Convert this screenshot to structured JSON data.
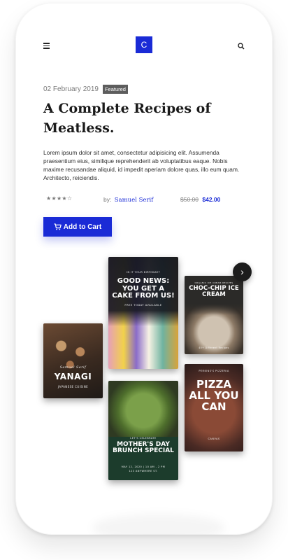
{
  "header": {
    "logo_letter": "C",
    "menu_icon": "hamburger-icon",
    "search_icon": "search-icon"
  },
  "post": {
    "date": "02 February 2019",
    "badge": "Featured",
    "title": "A Complete Recipes of Meatless.",
    "description": "Lorem ipsum dolor sit amet, consectetur adipisicing elit. Assumenda praesentium eius, similique reprehenderit ab voluptatibus eaque. Nobis maxime recusandae aliquid, id impedit aperiam dolore quas, illo eum quam. Architecto, reiciendis.",
    "rating_stars": "★★★★☆",
    "rating": 4,
    "author_prefix": "by:",
    "author_name": "Samuel Serif",
    "old_price": "$50.00",
    "new_price": "$42.00",
    "cart_label": "Add to Cart",
    "cart_icon": "cart-icon"
  },
  "books": [
    {
      "small_top": "IN IT YOUR BIRTHDAY?",
      "title": "GOOD NEWS: YOU GET A CAKE FROM US!",
      "subtitle": "FREE TODAY AVAILABLE"
    },
    {
      "small_top": "ORGANIC ICE CREAM RECIPES",
      "title": "CHOC-CHIP ICE CREAM",
      "subtitle": "40+ Different Recipes"
    },
    {
      "small_top": "Samuel Serif",
      "title": "YANAGI",
      "subtitle": "JAPANESE CUISINE"
    },
    {
      "small_top": "LET'S CELEBRATE",
      "title": "MOTHER'S DAY BRUNCH SPECIAL",
      "subtitle": "MAY 12, 2020 | 10 AM - 2 PM",
      "footer": "123 ANYWHERE ST."
    },
    {
      "small_top": "PERKINS'S PIZZERIA",
      "title": "PIZZA ALL YOU CAN",
      "subtitle": "CANVAS"
    }
  ],
  "carousel": {
    "next_icon": "chevron-right-icon",
    "next_glyph": "›"
  }
}
